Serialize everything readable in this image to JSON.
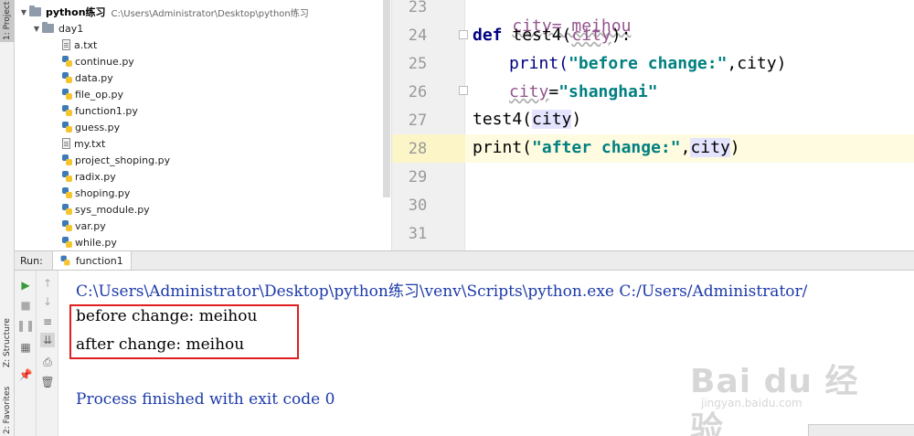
{
  "tool_windows": {
    "project_tab": "1: Project",
    "structure_tab": "Z: Structure",
    "favorites_tab": "2: Favorites"
  },
  "project_tree": {
    "root_name": "python练习",
    "root_path": "C:\\Users\\Administrator\\Desktop\\python练习",
    "folder": "day1",
    "files": [
      {
        "name": "a.txt",
        "icon": "text-file-icon"
      },
      {
        "name": "continue.py",
        "icon": "python-file-icon"
      },
      {
        "name": "data.py",
        "icon": "python-file-icon"
      },
      {
        "name": "file_op.py",
        "icon": "python-file-icon"
      },
      {
        "name": "function1.py",
        "icon": "python-file-icon"
      },
      {
        "name": "guess.py",
        "icon": "python-file-icon"
      },
      {
        "name": "my.txt",
        "icon": "text-file-icon"
      },
      {
        "name": "project_shoping.py",
        "icon": "python-file-icon"
      },
      {
        "name": "radix.py",
        "icon": "python-file-icon"
      },
      {
        "name": "shoping.py",
        "icon": "python-file-icon"
      },
      {
        "name": "sys_module.py",
        "icon": "python-file-icon"
      },
      {
        "name": "var.py",
        "icon": "python-file-icon"
      },
      {
        "name": "while.py",
        "icon": "python-file-icon"
      }
    ]
  },
  "editor": {
    "line_numbers": [
      "23",
      "24",
      "25",
      "26",
      "27",
      "28",
      "29",
      "30",
      "31"
    ],
    "line23": "city= meihou",
    "line24_kw": "def",
    "line24_fn": " test4(",
    "line24_param": "city",
    "line24_end": "):",
    "line25_fn": "print(",
    "line25_str": "\"before change:\"",
    "line25_end": ",city)",
    "line26_var": "city",
    "line26_eq": "=",
    "line26_str": "\"shanghai\"",
    "line27_fn": "test4(",
    "line27_arg": "city",
    "line27_end": ")",
    "line28_fn": "print(",
    "line28_str": "\"after change:\"",
    "line28_comma": ",",
    "line28_arg": "city",
    "line28_end": ")"
  },
  "run": {
    "label": "Run:",
    "tab": "function1",
    "command": "C:\\Users\\Administrator\\Desktop\\python练习\\venv\\Scripts\\python.exe C:/Users/Administrator/",
    "output": [
      "before change: meihou",
      "after change: meihou"
    ],
    "exit": "Process finished with exit code 0"
  },
  "watermark": {
    "main": "Bai du 经验",
    "sub": "jingyan.baidu.com"
  },
  "colors": {
    "keyword": "#000080",
    "string": "#008080",
    "console_blue": "#1c3aa8",
    "highlight_box": "#e02020"
  }
}
